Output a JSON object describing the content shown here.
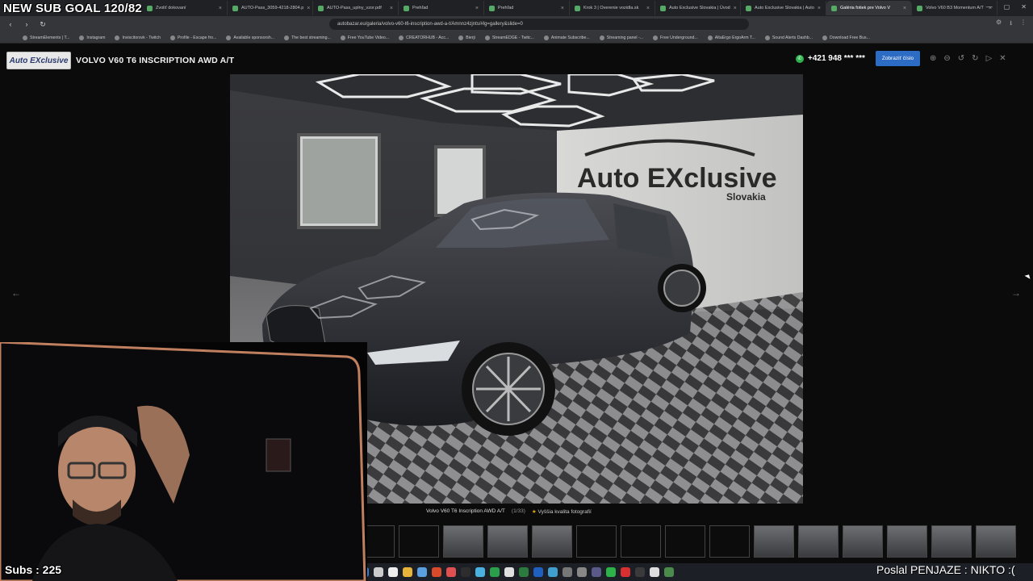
{
  "overlay": {
    "sub_goal": "NEW SUB GOAL 120/82",
    "subs_label": "Subs : 225",
    "ticker_text": "Poslal PENJAZE : NIKTO :("
  },
  "browser": {
    "tabs": [
      {
        "label": "Zvoliť dokovaní",
        "active": false
      },
      {
        "label": "AUTO-Pass_3059-4218-2804.p",
        "active": false
      },
      {
        "label": "AUTO-Pass_uplny_vzor.pdf",
        "active": false
      },
      {
        "label": "Prehľad",
        "active": false
      },
      {
        "label": "Prehľad",
        "active": false
      },
      {
        "label": "Krok 3 | Overenie vozidla.sk",
        "active": false
      },
      {
        "label": "Auto Exclusive Slovakia | Úvod",
        "active": false
      },
      {
        "label": "Auto Exclusive Slovakia | Auto",
        "active": false
      },
      {
        "label": "Galéria fotiek pre Volvo V",
        "active": true
      },
      {
        "label": "Volvo V60 B3 Momentum A/T",
        "active": false
      }
    ],
    "url": "autobazar.eu/galeria/volvo-v60-t6-inscription-awd-a-t/Amnnz4zjnts/#lg=gallery&slide=0",
    "bookmarks": [
      "StreamElements | T...",
      "Instagram",
      "Inviscitorsvk - Twitch",
      "Profile - Escape fro...",
      "Available sponsorsh...",
      "The best streaming...",
      "Free YouTube Video...",
      "CREATORHUB - Acc...",
      "Bierji",
      "StreamEDGE - Twitc...",
      "Animate Subscribe...",
      "Streaming panel -...",
      "Free Underground...",
      "AltaErgo ErgoArm T...",
      "Sound Alerts Dashb...",
      "Download Free Bus..."
    ]
  },
  "gallery": {
    "logo_text": "Auto EXclusive",
    "title": "VOLVO V60 T6 INSCRIPTION AWD A/T",
    "phone": "+421 948 *** ***",
    "show_number_label": "Zobraziť číslo",
    "photo_sign_main": "Auto EXclusive",
    "photo_sign_sub": "Slovakia",
    "caption_title": "Volvo V60 T6 Inscription AWD A/T",
    "caption_count": "(1/33)",
    "caption_hq": "Vyššia kvalita fotografií",
    "prev_arrow": "←",
    "next_arrow": "→"
  },
  "thumbnails": [
    {
      "filled": true
    },
    {
      "filled": false
    },
    {
      "filled": false
    },
    {
      "filled": true
    },
    {
      "filled": true
    },
    {
      "filled": true
    },
    {
      "filled": false
    },
    {
      "filled": false
    },
    {
      "filled": false
    },
    {
      "filled": false
    },
    {
      "filled": true
    },
    {
      "filled": true
    },
    {
      "filled": true
    },
    {
      "filled": true
    },
    {
      "filled": true
    },
    {
      "filled": true
    }
  ],
  "colors": {
    "accent": "#2d6cc4",
    "phone_green": "#2fb24d"
  }
}
